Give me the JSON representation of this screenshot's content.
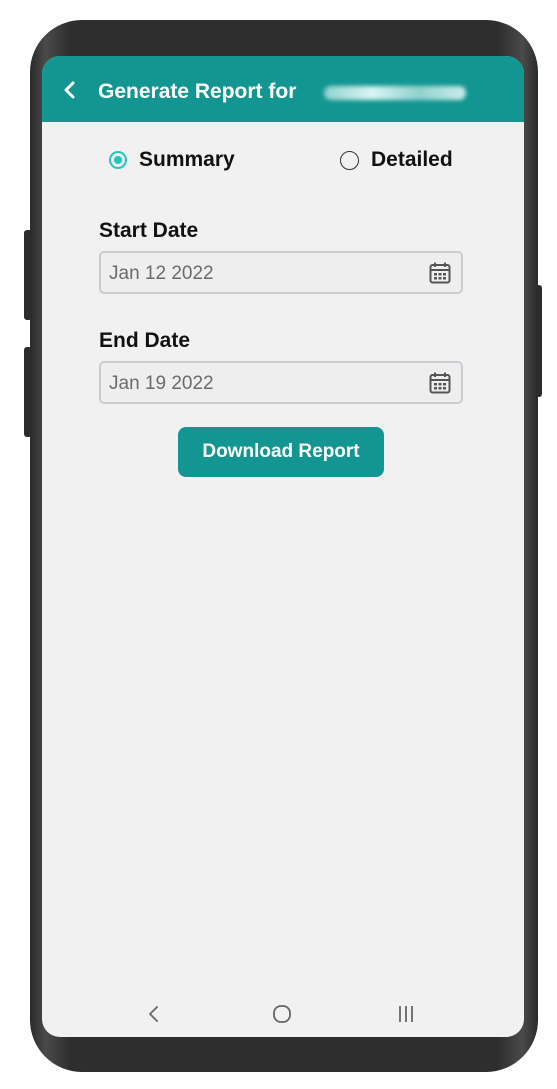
{
  "appbar": {
    "title": "Generate Report for",
    "back_icon": "chevron-left-icon"
  },
  "report_type": {
    "options": [
      {
        "label": "Summary",
        "checked": true
      },
      {
        "label": "Detailed",
        "checked": false
      }
    ]
  },
  "start_date": {
    "label": "Start Date",
    "value": "Jan 12 2022",
    "icon": "calendar-icon"
  },
  "end_date": {
    "label": "End Date",
    "value": "Jan 19 2022",
    "icon": "calendar-icon"
  },
  "actions": {
    "download_label": "Download Report"
  },
  "colors": {
    "primary": "#139691",
    "radio_accent": "#1ec8bd",
    "screen_bg": "#f1f1f1"
  },
  "system_nav": {
    "icons": [
      "back-nav-icon",
      "home-nav-icon",
      "recents-nav-icon"
    ]
  }
}
